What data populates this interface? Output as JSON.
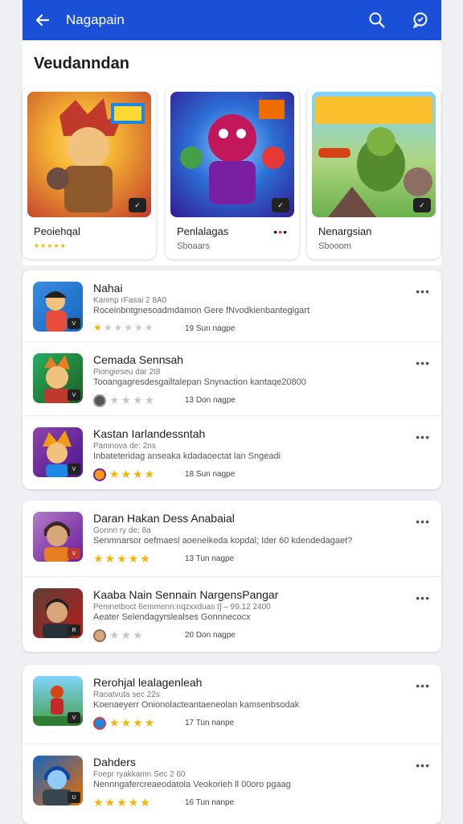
{
  "appbar": {
    "title": "Nagapain",
    "icons": [
      "back-arrow-icon",
      "search-icon",
      "chat-icon"
    ],
    "color": "#1a4fd8"
  },
  "featured": {
    "heading": "Veudanndan",
    "cards": [
      {
        "name": "Peoiehqal",
        "sub": "★★★★★",
        "badge": "✓",
        "art": [
          "#f7b733",
          "#c0392b"
        ]
      },
      {
        "name": "Penlalagas",
        "sub": "Sboaars",
        "badge": "✓",
        "art": [
          "#2c6fd6",
          "#8e44ad"
        ]
      },
      {
        "name": "Nenargsian",
        "sub": "Sbooom",
        "badge": "✓",
        "art": [
          "#6ab04c",
          "#f39c12"
        ]
      }
    ]
  },
  "list1": [
    {
      "title": "Nahai",
      "sub": "Kanmp rFasai 2 8A0",
      "desc": "Roceinbntgnesoadmdamon Gere fNvodkienbantegigart",
      "rating": 2,
      "meta": "19 Sun nagpe",
      "thumb": [
        "#3a8de0",
        "#e74c3c"
      ],
      "badge": "V"
    },
    {
      "title": "Cemada Sennsah",
      "sub": "Piongieseu dar 2t8",
      "desc": "Tooangagresdesgailtalepan Snynaction kantaqe20800",
      "rating": 1,
      "meta": "13 Don nagpe",
      "thumb": [
        "#27ae60",
        "#e67e22"
      ],
      "badge": "V"
    },
    {
      "title": "Kastan Iarlandessntah",
      "sub": "Pamnova de: 2ns",
      "desc": "Inbateteridag anseaka kdadaoectat lan Sngeadi",
      "rating": 4,
      "meta": "18 Sun nagpe",
      "thumb": [
        "#8e44ad",
        "#f39c12"
      ],
      "badge": "V"
    }
  ],
  "list2": [
    {
      "title": "Daran Hakan Dess Anabaial",
      "sub": "Gonnn ry de: 8a",
      "desc": "Senmnarsor oefmaesl aoeneikeda kopdal; Ider 60 kdendedagaet?",
      "rating": 5,
      "meta": "13 Tun nagpe",
      "thumb": [
        "#b07cc6",
        "#e67e22"
      ],
      "badge": "V"
    },
    {
      "title": "Kaaba Nain Sennain NargensPangar",
      "sub": "Pemnetboct 6emmenn:nqzxxduas t] – 99.12 2400",
      "desc": "Aeater Selendagyrslealses Gonnnecocx",
      "rating": 1,
      "meta": "20 Don nagpe",
      "thumb": [
        "#5d4037",
        "#c0392b"
      ],
      "badge": "R"
    }
  ],
  "list3": [
    {
      "title": "Rerohjal lealagenleah",
      "sub": "Raoatvuta sec 22s",
      "desc": "Koenaeyerr Onionolacteantaeneolan kamsenbsodak",
      "rating": 4,
      "meta": "17 Tun nanpe",
      "thumb": [
        "#43a047",
        "#d84315"
      ],
      "badge": "V"
    },
    {
      "title": "Dahders",
      "sub": "Foepr ryakkamn Sec 2 60",
      "desc": "Nennngafercreaeodatola Veokorieh ll 00oro pgaag",
      "rating": 5,
      "meta": "16 Tun nanpe",
      "thumb": [
        "#1565c0",
        "#ef6c00"
      ],
      "badge": "U"
    }
  ]
}
